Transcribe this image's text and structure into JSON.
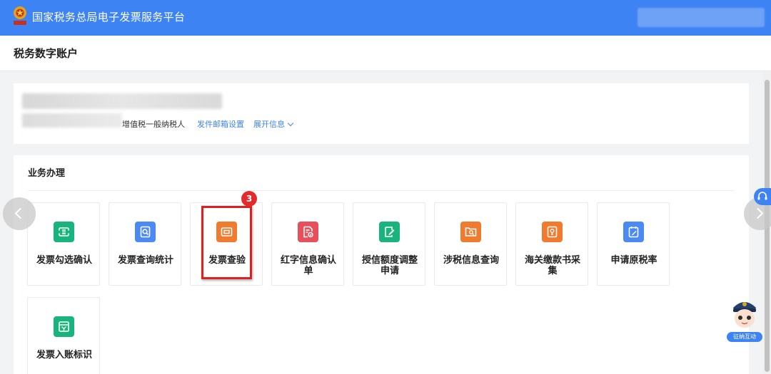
{
  "header": {
    "app_title": "国家税务总局电子发票服务平台",
    "brand_color": "#3e83f4"
  },
  "page_title": "税务数字账户",
  "account": {
    "taxpayer_type": "增值税一般纳税人",
    "email_link": "发件邮箱设置",
    "expand_link": "展开信息"
  },
  "business": {
    "section_title": "业务办理",
    "step_badge": "3",
    "tiles": [
      {
        "label": "发票勾选确认",
        "icon": "invoice-check-icon",
        "color": "#19b37e"
      },
      {
        "label": "发票查询统计",
        "icon": "invoice-search-icon",
        "color": "#4a8af2"
      },
      {
        "label": "发票查验",
        "icon": "invoice-verify-icon",
        "color": "#f07a2d"
      },
      {
        "label": "红字信息确认单",
        "icon": "red-letter-doc-icon",
        "color": "#e7505a"
      },
      {
        "label": "授信额度调整申请",
        "icon": "credit-edit-icon",
        "color": "#19b37e"
      },
      {
        "label": "涉税信息查询",
        "icon": "tax-info-search-icon",
        "color": "#f07a2d"
      },
      {
        "label": "海关缴款书采集",
        "icon": "customs-doc-icon",
        "color": "#f07a2d"
      },
      {
        "label": "申请原税率",
        "icon": "tax-rate-edit-icon",
        "color": "#4a8af2"
      },
      {
        "label": "发票入账标识",
        "icon": "invoice-ledger-icon",
        "color": "#19b37e"
      }
    ]
  },
  "assistant": {
    "tag": "征纳互动"
  }
}
